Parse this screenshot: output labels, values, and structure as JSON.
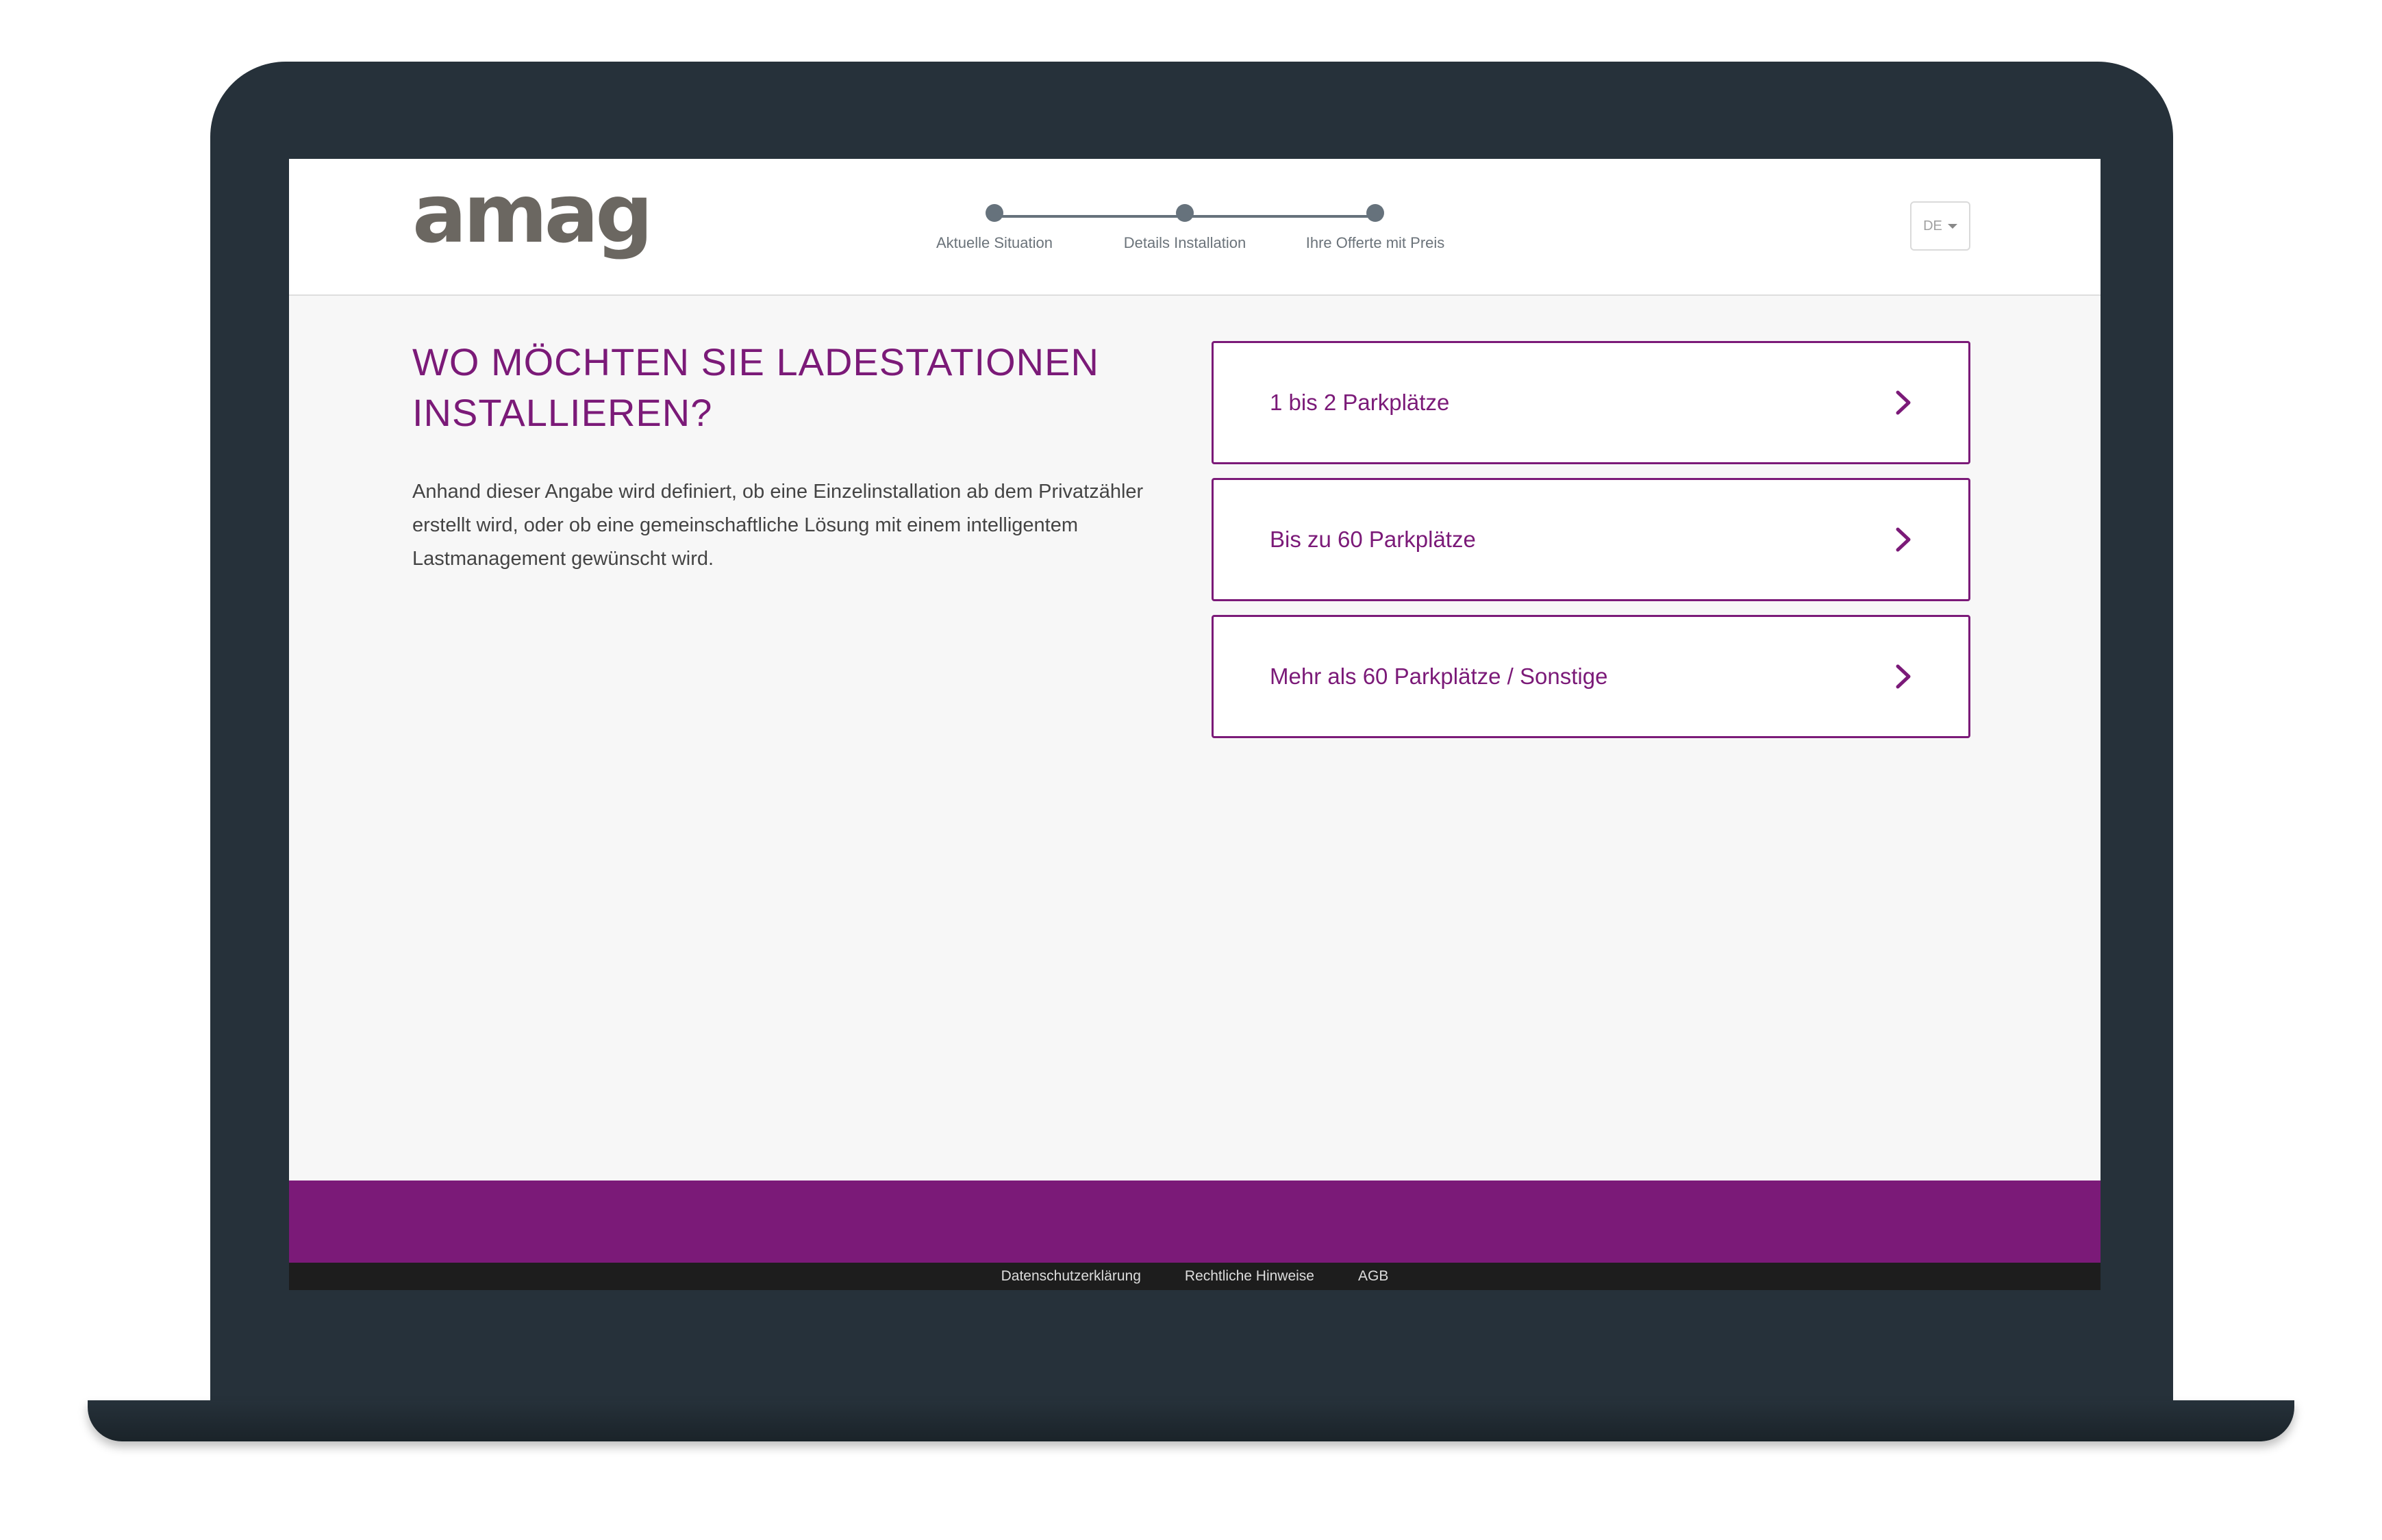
{
  "brand": {
    "logo_text": "amag"
  },
  "stepper": {
    "steps": [
      {
        "label": "Aktuelle Situation"
      },
      {
        "label": "Details Installation"
      },
      {
        "label": "Ihre Offerte mit Preis"
      }
    ]
  },
  "language": {
    "selected": "DE"
  },
  "main": {
    "title": "WO MÖCHTEN SIE LADESTATIONEN INSTALLIEREN?",
    "description": "Anhand dieser Angabe wird definiert, ob eine Einzelinstallation ab dem Privatzähler erstellt wird, oder ob eine gemeinschaftliche Lösung mit einem intelligentem Lastmanagement gewünscht wird.",
    "options": [
      {
        "label": "1 bis 2 Parkplätze",
        "icon": "chevron-right-icon"
      },
      {
        "label": "Bis zu 60 Parkplätze",
        "icon": "chevron-right-icon"
      },
      {
        "label": "Mehr als 60 Parkplätze / Sonstige",
        "icon": "chevron-right-icon"
      }
    ]
  },
  "footer": {
    "links": [
      "Datenschutzerklärung",
      "Rechtliche Hinweise",
      "AGB"
    ]
  },
  "colors": {
    "accent": "#7b1a78",
    "stepper": "#66727c",
    "logo": "#6b6761",
    "device": "#26313a"
  }
}
